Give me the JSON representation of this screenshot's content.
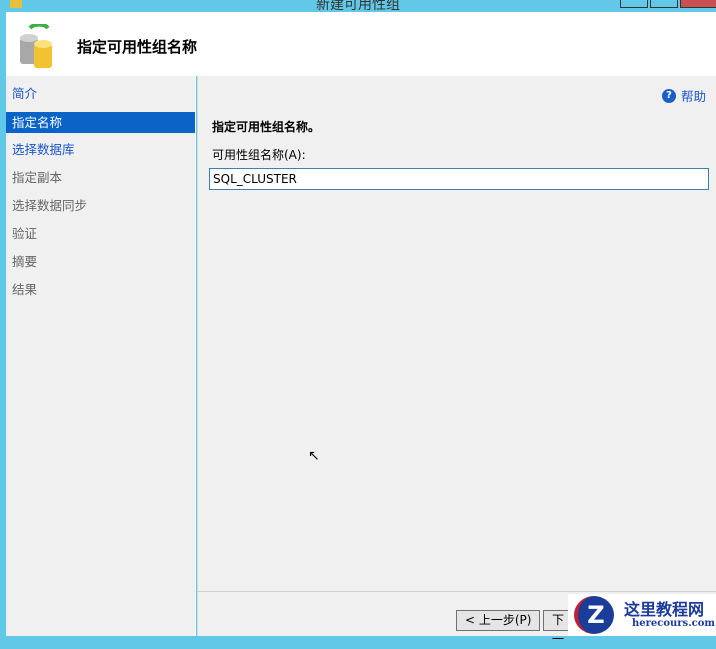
{
  "window": {
    "title": "新建可用性组"
  },
  "header": {
    "title": "指定可用性组名称"
  },
  "sidebar": {
    "items": [
      {
        "label": "简介",
        "state": "link"
      },
      {
        "label": "指定名称",
        "state": "selected"
      },
      {
        "label": "选择数据库",
        "state": "link"
      },
      {
        "label": "指定副本",
        "state": "disabled"
      },
      {
        "label": "选择数据同步",
        "state": "disabled"
      },
      {
        "label": "验证",
        "state": "disabled"
      },
      {
        "label": "摘要",
        "state": "disabled"
      },
      {
        "label": "结果",
        "state": "disabled"
      }
    ]
  },
  "main": {
    "help": "帮助",
    "subtitle": "指定可用性组名称。",
    "name_label": "可用性组名称(A):",
    "name_value": "SQL_CLUSTER"
  },
  "footer": {
    "prev": "< 上一步(P)",
    "next": "下一"
  },
  "watermark": {
    "line1": "这里教程网",
    "line2": "herecours.com",
    "logo": "Z"
  }
}
